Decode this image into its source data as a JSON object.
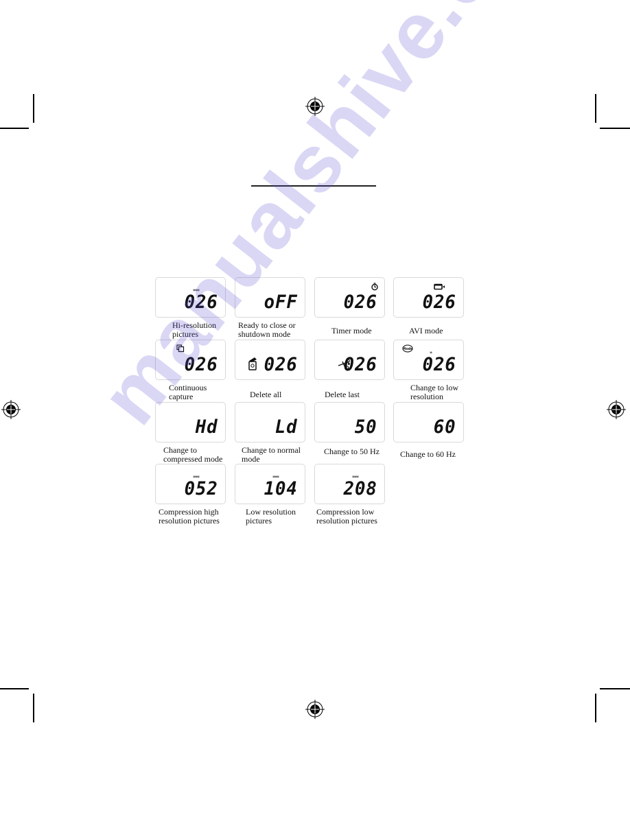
{
  "document": {
    "watermark_text": "manualshive.com",
    "watermark_color": "#5a4fd6",
    "title_rule_present": true
  },
  "indicators": [
    {
      "value": "026",
      "caption": [
        "Hi-resolution",
        "pictures"
      ],
      "icon": "three-stars-icon",
      "stars": "***"
    },
    {
      "value": "oFF",
      "caption": [
        "Ready to close or",
        "shutdown mode"
      ],
      "icon": "none"
    },
    {
      "value": "026",
      "caption": [
        "Timer mode"
      ],
      "icon": "timer-icon"
    },
    {
      "value": "026",
      "caption": [
        "AVI mode"
      ],
      "icon": "video-camera-icon"
    },
    {
      "value": "026",
      "caption": [
        "Continuous",
        "capture"
      ],
      "icon": "continuous-capture-icon"
    },
    {
      "value": "026",
      "caption": [
        "Delete all"
      ],
      "icon": "trash-bin-icon"
    },
    {
      "value": "026",
      "caption": [
        "Delete last"
      ],
      "icon": "scissors-icon"
    },
    {
      "value": "026",
      "caption": [
        "Change to low",
        "resolution"
      ],
      "icon": "mode-icon",
      "stars": "*",
      "mode_label": "Mode"
    },
    {
      "value": "Hd",
      "caption": [
        "Change to",
        "compressed mode"
      ],
      "icon": "none"
    },
    {
      "value": "Ld",
      "caption": [
        "Change to normal",
        "mode"
      ],
      "icon": "none"
    },
    {
      "value": "50",
      "caption": [
        "Change to 50 Hz"
      ],
      "icon": "none"
    },
    {
      "value": "60",
      "caption": [
        "Change to 60 Hz"
      ],
      "icon": "none"
    },
    {
      "value": "052",
      "caption": [
        "Compression high",
        "resolution pictures"
      ],
      "icon": "three-stars-icon",
      "stars": "***"
    },
    {
      "value": "104",
      "caption": [
        "Low resolution",
        "pictures"
      ],
      "icon": "three-stars-icon",
      "stars": "***"
    },
    {
      "value": "208",
      "caption": [
        "Compression low",
        "resolution pictures"
      ],
      "icon": "three-stars-icon",
      "stars": "***"
    }
  ]
}
